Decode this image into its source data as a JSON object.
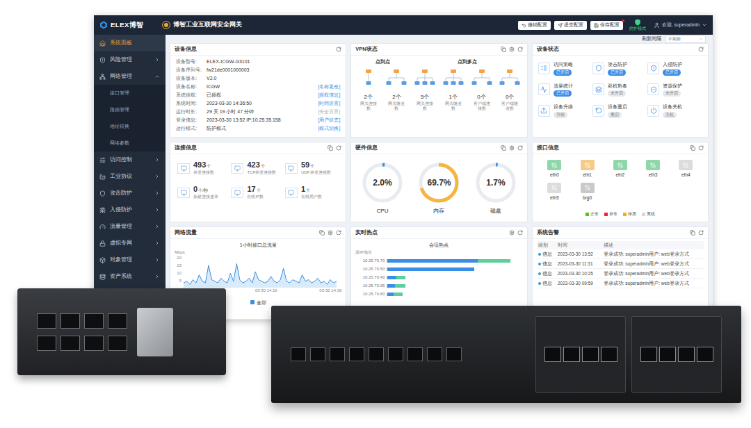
{
  "header": {
    "brand": "ELEX博智",
    "title": "博智工业互联网安全网关",
    "buttons": [
      {
        "label": "撤销配置",
        "badge": false
      },
      {
        "label": "提交配置",
        "badge": false
      },
      {
        "label": "保存配置",
        "badge": true
      }
    ],
    "mode": "防护模式",
    "user": "欢迎, superadmin"
  },
  "refresh": {
    "label": "刷新间隔",
    "value": "不刷新"
  },
  "sidebar": {
    "items": [
      {
        "label": "系统面板",
        "selected": true,
        "kind": "link",
        "expanded": false,
        "children": []
      },
      {
        "label": "风险管理",
        "selected": false,
        "kind": "group",
        "expanded": false,
        "children": []
      },
      {
        "label": "网络管理",
        "selected": false,
        "kind": "group",
        "expanded": true,
        "children": [
          {
            "label": "接口管理"
          },
          {
            "label": "路由管理"
          },
          {
            "label": "地址转换"
          },
          {
            "label": "网络参数"
          }
        ]
      },
      {
        "label": "访问控制",
        "selected": false,
        "kind": "group",
        "expanded": false,
        "children": []
      },
      {
        "label": "工业协议",
        "selected": false,
        "kind": "group",
        "expanded": false,
        "children": []
      },
      {
        "label": "攻击防护",
        "selected": false,
        "kind": "group",
        "expanded": false,
        "children": []
      },
      {
        "label": "入侵防护",
        "selected": false,
        "kind": "group",
        "expanded": false,
        "children": []
      },
      {
        "label": "流量管理",
        "selected": false,
        "kind": "group",
        "expanded": false,
        "children": []
      },
      {
        "label": "虚拟专网",
        "selected": false,
        "kind": "group",
        "expanded": false,
        "children": []
      },
      {
        "label": "对象管理",
        "selected": false,
        "kind": "group",
        "expanded": false,
        "children": []
      },
      {
        "label": "资产系统",
        "selected": false,
        "kind": "group",
        "expanded": false,
        "children": []
      }
    ]
  },
  "device_info": {
    "title": "设备信息",
    "rows": [
      {
        "label": "设备型号:",
        "value": "ELEX-ICGW-G3101",
        "action": "",
        "action_disabled": false
      },
      {
        "label": "设备序列号:",
        "value": "fw21de0001000003",
        "action": "",
        "action_disabled": false
      },
      {
        "label": "设备版本:",
        "value": "V2.0",
        "action": "",
        "action_disabled": false
      },
      {
        "label": "设备名称:",
        "value": "ICGW",
        "action": "[名称更改]",
        "action_disabled": false
      },
      {
        "label": "系统授权:",
        "value": "已授权",
        "action": "[授权信息]",
        "action_disabled": false
      },
      {
        "label": "系统时间:",
        "value": "2023-03-30 14:36:50",
        "action": "[时间设置]",
        "action_disabled": false
      },
      {
        "label": "运行时长:",
        "value": "29 天 19 小时 47 分钟",
        "action": "[安全设置]",
        "action_disabled": true
      },
      {
        "label": "登录信息:",
        "value": "2023-03-30 13:52   IP:10.25.35.158",
        "action": "[用户状态]",
        "action_disabled": false
      },
      {
        "label": "运行模式:",
        "value": "防护模式",
        "action": "[模式切换]",
        "action_disabled": false
      }
    ]
  },
  "vpn": {
    "title": "VPN状态",
    "groups": [
      {
        "title": "点到点",
        "stats": [
          {
            "value": "2个",
            "label": "网关连接数"
          },
          {
            "value": "2个",
            "label": "网关隧道数"
          }
        ]
      },
      {
        "title": "点到多点",
        "stats": [
          {
            "value": "5个",
            "label": "网关连接数"
          },
          {
            "value": "1个",
            "label": "网关隧道数"
          },
          {
            "value": "0个",
            "label": "客户端连接数"
          },
          {
            "value": "0个",
            "label": "客户端隧道数"
          }
        ]
      }
    ]
  },
  "device_status": {
    "title": "设备状态",
    "items": [
      {
        "label": "访问策略",
        "status": "已开启",
        "on": true
      },
      {
        "label": "攻击防护",
        "status": "已开启",
        "on": true
      },
      {
        "label": "入侵防护",
        "status": "已开启",
        "on": true
      },
      {
        "label": "流量统计",
        "status": "已开启",
        "on": true
      },
      {
        "label": "双机热备",
        "status": "未开启",
        "on": false
      },
      {
        "label": "资源保护",
        "status": "未开启",
        "on": false
      },
      {
        "label": "设备升级",
        "status": "升级",
        "on": false
      },
      {
        "label": "设备重启",
        "status": "重启",
        "on": false
      },
      {
        "label": "设备关机",
        "status": "关机",
        "on": false
      }
    ]
  },
  "connections": {
    "title": "连接信息",
    "items": [
      {
        "value": "493",
        "unit": "个",
        "label": "并发连接数"
      },
      {
        "value": "423",
        "unit": "个",
        "label": "TCP并发连接数"
      },
      {
        "value": "59",
        "unit": "个",
        "label": "UDP并发连接数"
      },
      {
        "value": "0",
        "unit": "个/秒",
        "label": "新建连接速率"
      },
      {
        "value": "17",
        "unit": "个",
        "label": "在线IP数"
      },
      {
        "value": "1",
        "unit": "个",
        "label": "在线用户数"
      }
    ]
  },
  "hardware": {
    "title": "硬件信息",
    "gauges": [
      {
        "label": "CPU",
        "reading": "2.0%",
        "level": 0.02,
        "color": "#3b8be8"
      },
      {
        "label": "内存",
        "reading": "69.7%",
        "level": 0.697,
        "color": "#f5b53f"
      },
      {
        "label": "磁盘",
        "reading": "1.7%",
        "level": 0.017,
        "color": "#3b8be8"
      }
    ]
  },
  "interfaces": {
    "title": "接口信息",
    "items": [
      {
        "name": "eth0",
        "color": "#8fd6a8"
      },
      {
        "name": "eth1",
        "color": "#f6cb8a"
      },
      {
        "name": "eth2",
        "color": "#8fd6a8"
      },
      {
        "name": "eth3",
        "color": "#8fd6a8"
      },
      {
        "name": "eth4",
        "color": "#dcdcdc"
      },
      {
        "name": "eth5",
        "color": "#dcdcdc"
      },
      {
        "name": "brg0",
        "color": "#c9c9c9"
      }
    ],
    "legend": [
      {
        "label": "正常",
        "color": "#52c41a"
      },
      {
        "label": "异常",
        "color": "#f5222d"
      },
      {
        "label": "停用",
        "color": "#faad14"
      },
      {
        "label": "离线",
        "color": "#d9d9d9"
      }
    ]
  },
  "traffic": {
    "title": "网络流量",
    "chart_title": "1小时接口总流量",
    "unit": "Mbps",
    "y_ticks": [
      "20",
      "15",
      "10",
      "5"
    ],
    "y_max": 20,
    "x_labels": [
      "13:57",
      "03-30 14:16",
      "03-30 14:36"
    ],
    "values": [
      3,
      4,
      2,
      5,
      3,
      8,
      4,
      3,
      14,
      5,
      4,
      3,
      6,
      4,
      3,
      9,
      4,
      15,
      5,
      3,
      4,
      6,
      3,
      10,
      5,
      4,
      3,
      4,
      7,
      4,
      3,
      5,
      12,
      4,
      3,
      5,
      4,
      3,
      8,
      4,
      5,
      3,
      4,
      6,
      3,
      4,
      2,
      5,
      3,
      4
    ],
    "legend": {
      "label": "全部",
      "checked": true
    }
  },
  "hotspots": {
    "title": "实时热点",
    "chart_title": "会话热点",
    "axis_label": "源IP地址",
    "ips": [
      "10.25.70.70",
      "10.25.70.50",
      "10.25.70.43",
      "10.25.70.65",
      "10.25.70.60"
    ],
    "series": [
      {
        "color": "#3a8ee6",
        "values": [
          60,
          58,
          6,
          5,
          4
        ]
      },
      {
        "color": "#5ccf9c",
        "values": [
          22,
          0,
          6,
          7,
          6
        ]
      }
    ]
  },
  "alarms": {
    "title": "系统告警",
    "columns": [
      "级别",
      "时间",
      "描述"
    ],
    "rows": [
      {
        "level": "信息",
        "color": "#2f9bd6",
        "time": "2023-03-30 13:52",
        "desc": "登录成功: superadmin用户: web登录方式"
      },
      {
        "level": "信息",
        "color": "#2f9bd6",
        "time": "2023-03-30 11:31",
        "desc": "登录成功: superadmin用户: web登录方式"
      },
      {
        "level": "信息",
        "color": "#2f9bd6",
        "time": "2023-03-30 10:25",
        "desc": "登录成功: superadmin用户: web登录方式"
      },
      {
        "level": "信息",
        "color": "#2f9bd6",
        "time": "2023-03-30 09:59",
        "desc": "登录成功: superadmin用户: web登录方式"
      }
    ]
  }
}
